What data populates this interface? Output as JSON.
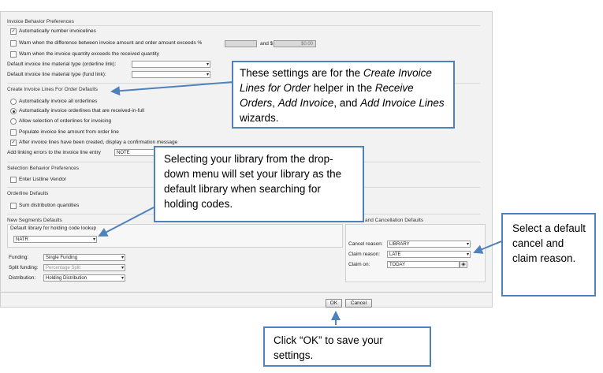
{
  "invoice_behavior": {
    "title": "Invoice Behavior Preferences",
    "auto_number_label": "Automatically number invoicelines",
    "auto_number_check": "✓",
    "warn_diff_label": "Warn when the difference between invoice amount and order amount exceeds %",
    "warn_and_label": "and $",
    "warn_amount_value": "$0.00",
    "warn_qty_label": "Warn when the invoice quantity exceeds the received quantity",
    "material_orderline_label": "Default invoice line material type (orderline link):",
    "material_fund_label": "Default invoice line material type (fund link):"
  },
  "create_lines": {
    "title": "Create Invoice Lines For Order Defaults",
    "opt_all": "Automatically invoice all orderlines",
    "opt_received": "Automatically invoice orderlines that are received-in-full",
    "opt_selection": "Allow selection of orderlines for invoicing",
    "populate_label": "Populate invoice line amount from order line",
    "confirm_label": "After invoice lines have been created, display a confirmation message",
    "confirm_check": "✓",
    "linking_label": "Add linking errors to the invoice line entry",
    "linking_value": "NOTE"
  },
  "selection_behavior": {
    "title": "Selection Behavior Preferences",
    "listline_label": "Enter Listline Vendor"
  },
  "orderline": {
    "title": "Orderline Defaults",
    "sum_label": "Sum distribution quantities"
  },
  "new_segments": {
    "title": "New Segments Defaults",
    "library_label": "Default library for holding code lookup",
    "library_value": "NATR",
    "funding_label": "Funding:",
    "funding_value": "Single Funding",
    "split_label": "Split funding:",
    "split_value": "Percentage Split",
    "distribution_label": "Distribution:",
    "distribution_value": "Holding Distribution"
  },
  "cancellation": {
    "title": "and Cancellation Defaults",
    "cancel_label": "Cancel reason:",
    "cancel_value": "LIBRARY",
    "claim_label": "Claim reason:",
    "claim_value": "LATE",
    "claim_on_label": "Claim on:",
    "claim_on_value": "TODAY"
  },
  "buttons": {
    "ok": "OK",
    "cancel": "Cancel"
  },
  "callouts": {
    "create_lines": [
      "These settings are for the ",
      "Create Invoice Lines for Order",
      " helper in the ",
      "Receive Orders",
      ", ",
      "Add Invoice",
      ", and ",
      "Add Invoice Lines",
      " wizards."
    ],
    "library": "Selecting your library from the drop-down menu will set your library as the default library when searching for holding codes.",
    "cancel_claim": "Select a default cancel and claim reason.",
    "ok": "Click “OK” to save your settings."
  },
  "icons": {
    "dropdown": "▾",
    "date_picker": "◈"
  },
  "colors": {
    "callout_border": "#4f81bd",
    "arrow": "#4f81bd"
  }
}
